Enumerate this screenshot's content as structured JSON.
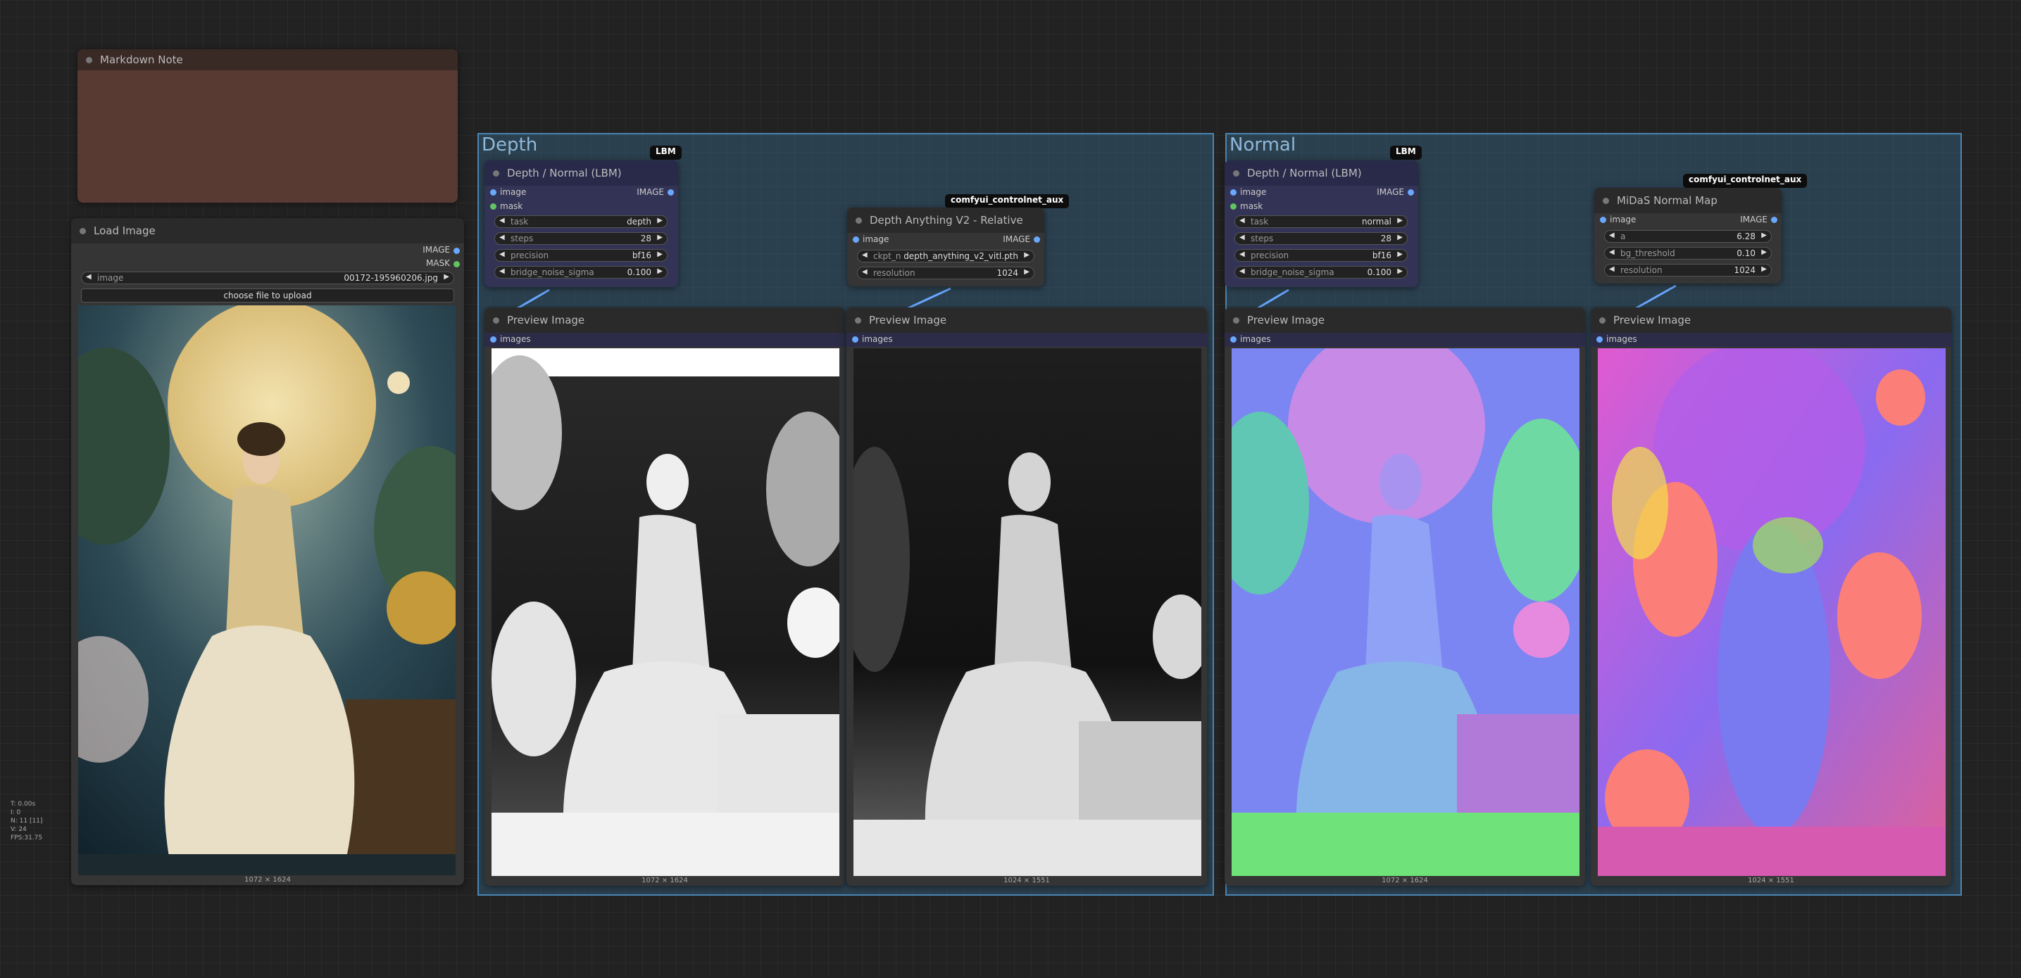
{
  "stats": {
    "t": "T: 0.00s",
    "i": "I: 0",
    "n": "N: 11 [11]",
    "v": "V: 24",
    "fps": "FPS:31.75"
  },
  "markdown_note": {
    "title": "Markdown Note"
  },
  "load_image": {
    "title": "Load Image",
    "outputs": [
      "IMAGE",
      "MASK"
    ],
    "image_label": "image",
    "image_value": "00172-195960206.jpg",
    "upload_label": "choose file to upload",
    "dims": "1072 × 1624"
  },
  "groups": {
    "depth": "Depth",
    "normal": "Normal"
  },
  "depth_lbm": {
    "badge": "LBM",
    "title": "Depth / Normal (LBM)",
    "inputs": [
      "image",
      "mask"
    ],
    "output": "IMAGE",
    "widgets": [
      {
        "label": "task",
        "value": "depth"
      },
      {
        "label": "steps",
        "value": "28"
      },
      {
        "label": "precision",
        "value": "bf16"
      },
      {
        "label": "bridge_noise_sigma",
        "value": "0.100"
      }
    ]
  },
  "depth_anything": {
    "badge": "comfyui_controlnet_aux",
    "title": "Depth Anything V2 - Relative",
    "input": "image",
    "output": "IMAGE",
    "widgets": [
      {
        "label": "ckpt_n",
        "value": "depth_anything_v2_vitl.pth"
      },
      {
        "label": "resolution",
        "value": "1024"
      }
    ]
  },
  "normal_lbm": {
    "badge": "LBM",
    "title": "Depth / Normal (LBM)",
    "inputs": [
      "image",
      "mask"
    ],
    "output": "IMAGE",
    "widgets": [
      {
        "label": "task",
        "value": "normal"
      },
      {
        "label": "steps",
        "value": "28"
      },
      {
        "label": "precision",
        "value": "bf16"
      },
      {
        "label": "bridge_noise_sigma",
        "value": "0.100"
      }
    ]
  },
  "midas": {
    "badge": "comfyui_controlnet_aux",
    "title": "MiDaS Normal Map",
    "input": "image",
    "output": "IMAGE",
    "widgets": [
      {
        "label": "a",
        "value": "6.28"
      },
      {
        "label": "bg_threshold",
        "value": "0.10"
      },
      {
        "label": "resolution",
        "value": "1024"
      }
    ]
  },
  "previews": [
    {
      "title": "Preview Image",
      "input": "images",
      "dims": "1072 × 1624"
    },
    {
      "title": "Preview Image",
      "input": "images",
      "dims": "1024 × 1551"
    },
    {
      "title": "Preview Image",
      "input": "images",
      "dims": "1072 × 1624"
    },
    {
      "title": "Preview Image",
      "input": "images",
      "dims": "1024 × 1551"
    }
  ],
  "colors": {
    "canvas": "#222222",
    "group": "#3a7298",
    "node": "#353535",
    "lbm_node": "#333355",
    "note": "#5a3a32",
    "link": "#6aa8ff"
  }
}
